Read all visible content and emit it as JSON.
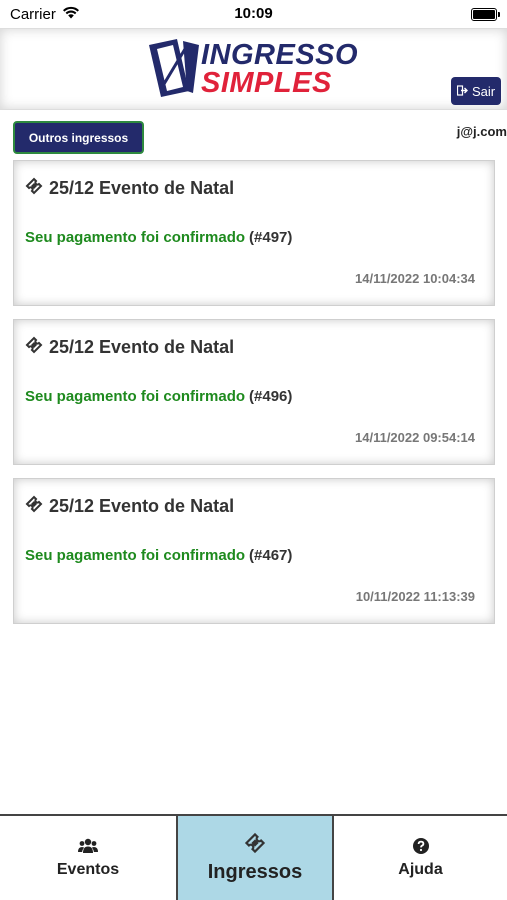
{
  "status_bar": {
    "carrier": "Carrier",
    "time": "10:09"
  },
  "header": {
    "logo_line1": "INGRESSO",
    "logo_line2": "SIMPLES",
    "logout_label": "Sair"
  },
  "toolbar": {
    "other_tickets_label": "Outros ingressos",
    "user_email": "j@j.com"
  },
  "tickets": [
    {
      "title": "25/12 Evento de Natal",
      "status": "Seu pagamento foi confirmado",
      "order": "(#497)",
      "datetime": "14/11/2022 10:04:34"
    },
    {
      "title": "25/12 Evento de Natal",
      "status": "Seu pagamento foi confirmado",
      "order": "(#496)",
      "datetime": "14/11/2022 09:54:14"
    },
    {
      "title": "25/12 Evento de Natal",
      "status": "Seu pagamento foi confirmado",
      "order": "(#467)",
      "datetime": "10/11/2022 11:13:39"
    }
  ],
  "tabs": [
    {
      "label": "Eventos",
      "icon": "users-icon",
      "active": false
    },
    {
      "label": "Ingressos",
      "icon": "ticket-icon",
      "active": true
    },
    {
      "label": "Ajuda",
      "icon": "question-circle-icon",
      "active": false
    }
  ],
  "colors": {
    "brand_navy": "#232a6b",
    "brand_red": "#e0223a",
    "status_green": "#1e8a1e",
    "active_tab": "#add8e6"
  }
}
